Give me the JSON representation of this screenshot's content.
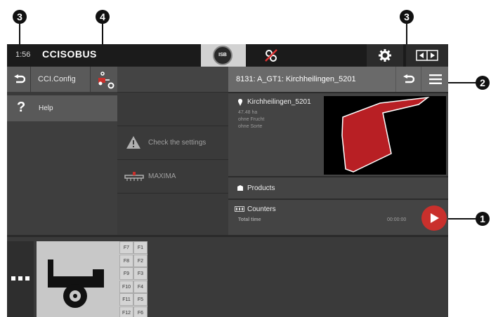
{
  "topbar": {
    "time": "1:56",
    "brand": "CCISOBUS",
    "isb_label": "ISB"
  },
  "left": {
    "title": "CCI.Config",
    "help_label": "Help"
  },
  "middle": {
    "items": [
      {
        "label": "Check the settings"
      },
      {
        "label": "MAXIMA"
      }
    ]
  },
  "right": {
    "header_title": "8131: A_GT1: Kirchheilingen_5201",
    "field_name": "Kirchheilingen_5201",
    "field_area": "47.48 ha",
    "field_crop": "ohne Frucht",
    "field_variety": "ohne Sorte",
    "products_label": "Products",
    "counters_label": "Counters",
    "counters_sub": "Total time",
    "counters_value": "00:00:00"
  },
  "fkeys": {
    "left": [
      "F7",
      "F8",
      "F9",
      "F10",
      "F11",
      "F12"
    ],
    "right": [
      "F1",
      "F2",
      "F3",
      "F4",
      "F5",
      "F6"
    ]
  },
  "callouts": {
    "c1": "1",
    "c2": "2",
    "c3a": "3",
    "c3b": "3",
    "c4": "4"
  },
  "colors": {
    "field_fill": "#b81f24",
    "play_button": "#c9302c",
    "warning": "#b0b0b0"
  }
}
